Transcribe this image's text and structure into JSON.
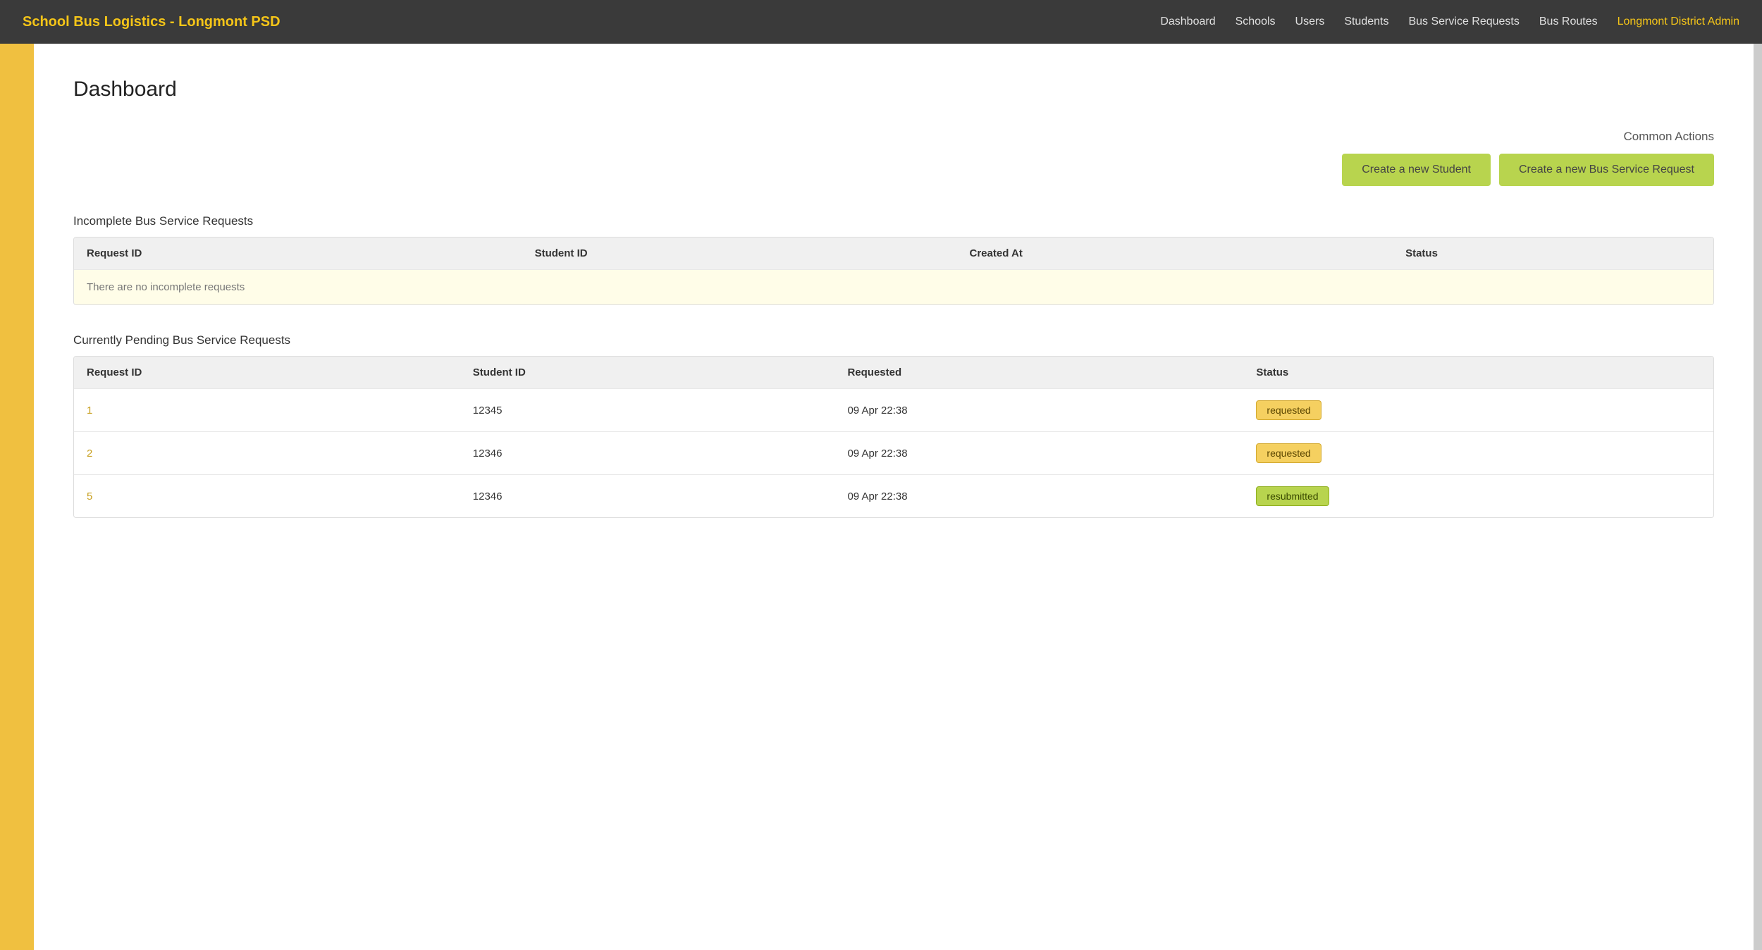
{
  "app": {
    "brand": "School Bus Logistics - Longmont PSD",
    "nav_links": [
      {
        "label": "Dashboard",
        "href": "#"
      },
      {
        "label": "Schools",
        "href": "#"
      },
      {
        "label": "Users",
        "href": "#"
      },
      {
        "label": "Students",
        "href": "#"
      },
      {
        "label": "Bus Service Requests",
        "href": "#"
      },
      {
        "label": "Bus Routes",
        "href": "#"
      }
    ],
    "user_label": "Longmont District Admin"
  },
  "page": {
    "title": "Dashboard"
  },
  "common_actions": {
    "label": "Common Actions",
    "btn_new_student": "Create a new Student",
    "btn_new_bus_request": "Create a new Bus Service Request"
  },
  "incomplete_section": {
    "title": "Incomplete Bus Service Requests",
    "columns": [
      "Request ID",
      "Student ID",
      "Created At",
      "Status"
    ],
    "empty_message": "There are no incomplete requests",
    "rows": []
  },
  "pending_section": {
    "title": "Currently Pending Bus Service Requests",
    "columns": [
      "Request ID",
      "Student ID",
      "Requested",
      "Status"
    ],
    "rows": [
      {
        "id": "1",
        "student_id": "12345",
        "requested": "09 Apr 22:38",
        "status": "requested",
        "badge_type": "requested"
      },
      {
        "id": "2",
        "student_id": "12346",
        "requested": "09 Apr 22:38",
        "status": "requested",
        "badge_type": "requested"
      },
      {
        "id": "5",
        "student_id": "12346",
        "requested": "09 Apr 22:38",
        "status": "resubmitted",
        "badge_type": "resubmitted"
      }
    ]
  }
}
